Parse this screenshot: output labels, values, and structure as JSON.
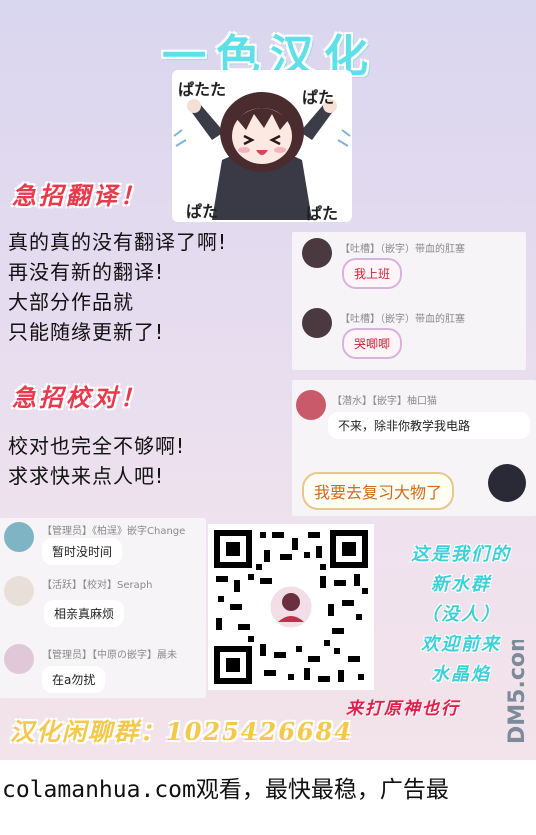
{
  "header": {
    "group_name": "一色汉化"
  },
  "mascot": {
    "sound_effects": [
      "ぱたた",
      "ぱた",
      "ぱた",
      "ぱた"
    ]
  },
  "urgent_translator": {
    "title": "急招翻译！",
    "lines": [
      "真的真的没有翻译了啊!",
      "再没有新的翻译!",
      "大部分作品就",
      "只能随缘更新了!"
    ]
  },
  "urgent_proofreader": {
    "title": "急招校对！",
    "lines": [
      "校对也完全不够啊!",
      "求求快来点人吧!"
    ]
  },
  "chat_top": [
    {
      "meta": "【吐槽】（嵌字）带血的肛塞",
      "message": "我上班"
    },
    {
      "meta": "【吐槽】（嵌字）带血的肛塞",
      "message": "哭唧唧"
    }
  ],
  "chat_mid": {
    "meta": "【潜水】【嵌字】柚口猫",
    "message": "不来，除非你教学我电路",
    "reply": "我要去复习大物了"
  },
  "chat_left": [
    {
      "meta": "【管理员】《柏逞》嵌字Change",
      "message": "暂时没时间"
    },
    {
      "meta": "【活跃】【校对】Seraph",
      "message": "相亲真麻烦"
    },
    {
      "meta": "【管理员】【中原の嵌字】晨未",
      "message": "在a勿扰"
    }
  ],
  "promo": {
    "lines": [
      "这是我们的",
      "新水群",
      "（没人）",
      "欢迎前来",
      "水晶焰"
    ],
    "tagline": "来打原神也行"
  },
  "chat_group": {
    "label": "汉化闲聊群：1025426684"
  },
  "watermark": {
    "text": "DM5.com"
  },
  "site_banner": {
    "text": "colamanhua.com观看，最快最稳，广告最"
  }
}
